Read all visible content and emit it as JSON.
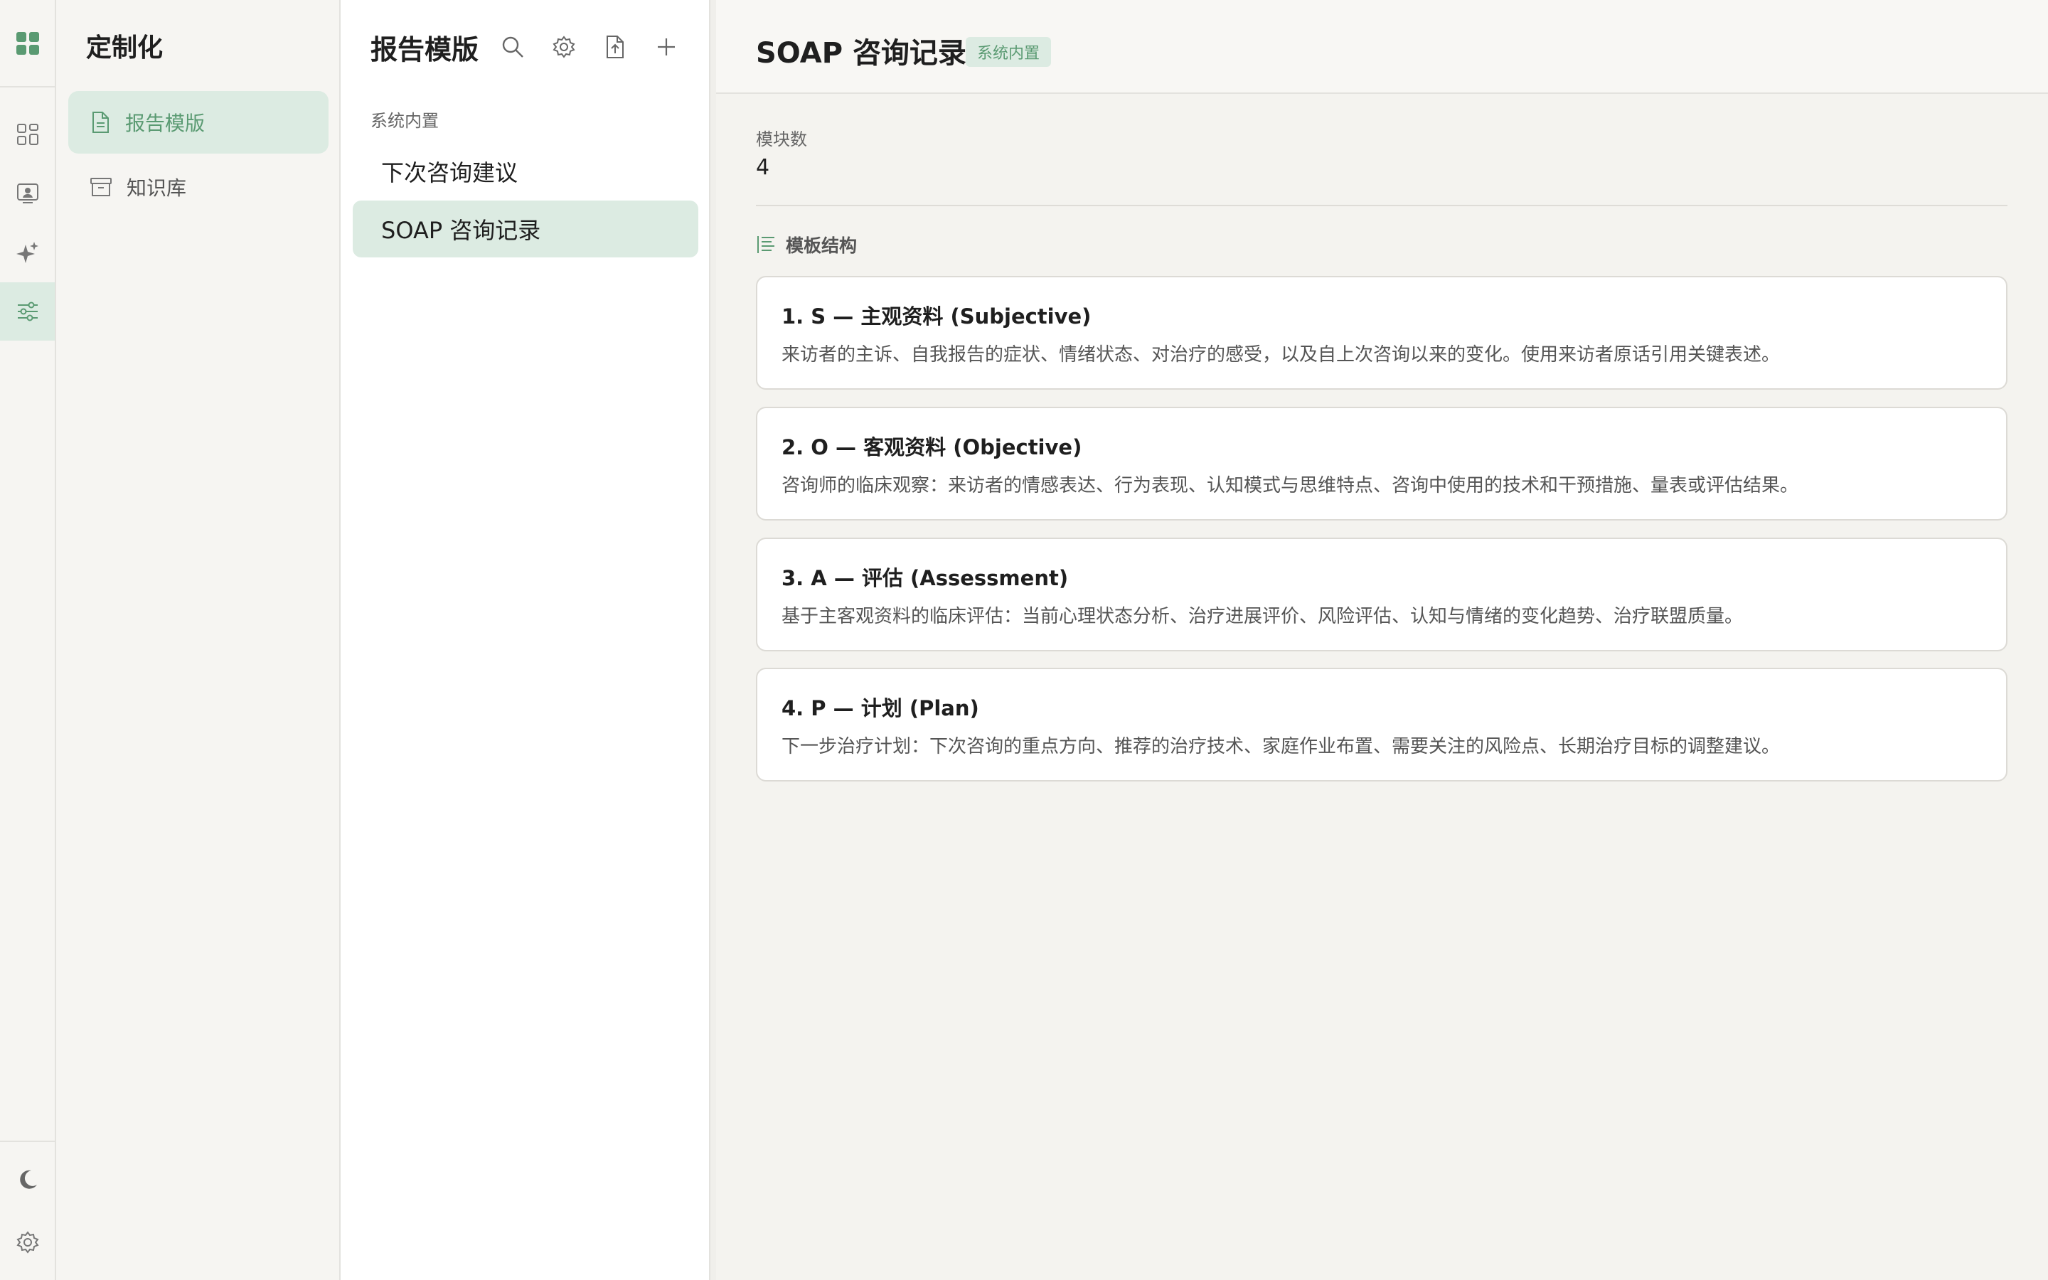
{
  "rail": {
    "items": [
      "grid-icon",
      "profile-icon",
      "sparkle-icon",
      "sliders-icon"
    ],
    "bottom": [
      "moon-icon",
      "gear-icon"
    ]
  },
  "sidebar": {
    "title": "定制化",
    "items": [
      {
        "label": "报告模版",
        "icon": "document-icon",
        "active": true
      },
      {
        "label": "知识库",
        "icon": "archive-icon",
        "active": false
      }
    ]
  },
  "template_list": {
    "title": "报告模版",
    "group_label": "系统内置",
    "items": [
      {
        "label": "下次咨询建议",
        "active": false
      },
      {
        "label": "SOAP 咨询记录",
        "active": true
      }
    ]
  },
  "main": {
    "title": "SOAP 咨询记录",
    "badge": "系统内置",
    "module_count_label": "模块数",
    "module_count_value": "4",
    "section_label": "模板结构",
    "modules": [
      {
        "title": "1. S — 主观资料 (Subjective)",
        "description": "来访者的主诉、自我报告的症状、情绪状态、对治疗的感受，以及自上次咨询以来的变化。使用来访者原话引用关键表述。"
      },
      {
        "title": "2. O — 客观资料 (Objective)",
        "description": "咨询师的临床观察：来访者的情感表达、行为表现、认知模式与思维特点、咨询中使用的技术和干预措施、量表或评估结果。"
      },
      {
        "title": "3. A — 评估 (Assessment)",
        "description": "基于主客观资料的临床评估：当前心理状态分析、治疗进展评价、风险评估、认知与情绪的变化趋势、治疗联盟质量。"
      },
      {
        "title": "4. P — 计划 (Plan)",
        "description": "下一步治疗计划：下次咨询的重点方向、推荐的治疗技术、家庭作业布置、需要关注的风险点、长期治疗目标的调整建议。"
      }
    ]
  },
  "colors": {
    "accent": "#5a9a72",
    "accent_bg": "#dcebe2"
  }
}
